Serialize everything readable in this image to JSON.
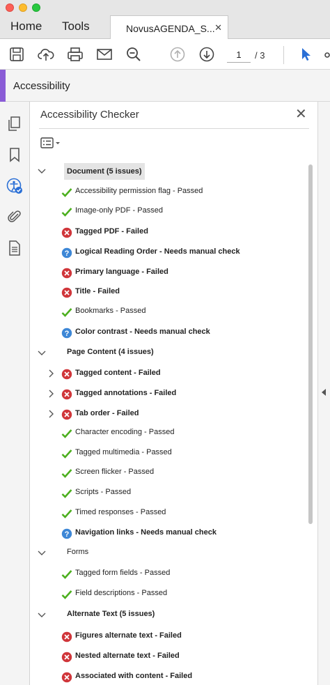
{
  "tabs": {
    "home": "Home",
    "tools": "Tools",
    "document": "NovusAGENDA_S...",
    "close_glyph": "✕"
  },
  "toolbar": {
    "current_page": "1",
    "total_pages": "/ 3"
  },
  "accessibility_header": "Accessibility",
  "panel": {
    "title": "Accessibility Checker",
    "close_glyph": "✕"
  },
  "status_colors": {
    "passed": "#4caf1e",
    "failed": "#d0363a",
    "manual": "#3d87d6",
    "accent": "#8a5cd6"
  },
  "tree": [
    {
      "type": "group",
      "label": "Document (5 issues)",
      "bold": true,
      "highlight": true,
      "expanded": true
    },
    {
      "type": "item",
      "status": "passed",
      "label": "Accessibility permission flag - Passed",
      "bold": false
    },
    {
      "type": "item",
      "status": "passed",
      "label": "Image-only PDF - Passed",
      "bold": false
    },
    {
      "type": "item",
      "status": "failed",
      "label": "Tagged PDF - Failed",
      "bold": true
    },
    {
      "type": "item",
      "status": "manual",
      "label": "Logical Reading Order - Needs manual check",
      "bold": true
    },
    {
      "type": "item",
      "status": "failed",
      "label": "Primary language - Failed",
      "bold": true
    },
    {
      "type": "item",
      "status": "failed",
      "label": "Title - Failed",
      "bold": true
    },
    {
      "type": "item",
      "status": "passed",
      "label": "Bookmarks - Passed",
      "bold": false
    },
    {
      "type": "item",
      "status": "manual",
      "label": "Color contrast - Needs manual check",
      "bold": true
    },
    {
      "type": "group",
      "label": "Page Content (4 issues)",
      "bold": true,
      "highlight": false,
      "expanded": true
    },
    {
      "type": "item",
      "status": "failed",
      "label": "Tagged content - Failed",
      "bold": true,
      "expandable": true
    },
    {
      "type": "item",
      "status": "failed",
      "label": "Tagged annotations - Failed",
      "bold": true,
      "expandable": true
    },
    {
      "type": "item",
      "status": "failed",
      "label": "Tab order - Failed",
      "bold": true,
      "expandable": true
    },
    {
      "type": "item",
      "status": "passed",
      "label": "Character encoding - Passed",
      "bold": false
    },
    {
      "type": "item",
      "status": "passed",
      "label": "Tagged multimedia - Passed",
      "bold": false
    },
    {
      "type": "item",
      "status": "passed",
      "label": "Screen flicker - Passed",
      "bold": false
    },
    {
      "type": "item",
      "status": "passed",
      "label": "Scripts - Passed",
      "bold": false
    },
    {
      "type": "item",
      "status": "passed",
      "label": "Timed responses - Passed",
      "bold": false
    },
    {
      "type": "item",
      "status": "manual",
      "label": "Navigation links - Needs manual check",
      "bold": true
    },
    {
      "type": "group",
      "label": "Forms",
      "bold": false,
      "highlight": false,
      "expanded": true
    },
    {
      "type": "item",
      "status": "passed",
      "label": "Tagged form fields - Passed",
      "bold": false
    },
    {
      "type": "item",
      "status": "passed",
      "label": "Field descriptions - Passed",
      "bold": false
    },
    {
      "type": "group",
      "label": "Alternate Text (5 issues)",
      "bold": true,
      "highlight": false,
      "expanded": true
    },
    {
      "type": "item",
      "status": "failed",
      "label": "Figures alternate text - Failed",
      "bold": true
    },
    {
      "type": "item",
      "status": "failed",
      "label": "Nested alternate text - Failed",
      "bold": true
    },
    {
      "type": "item",
      "status": "failed",
      "label": "Associated with content - Failed",
      "bold": true
    }
  ]
}
